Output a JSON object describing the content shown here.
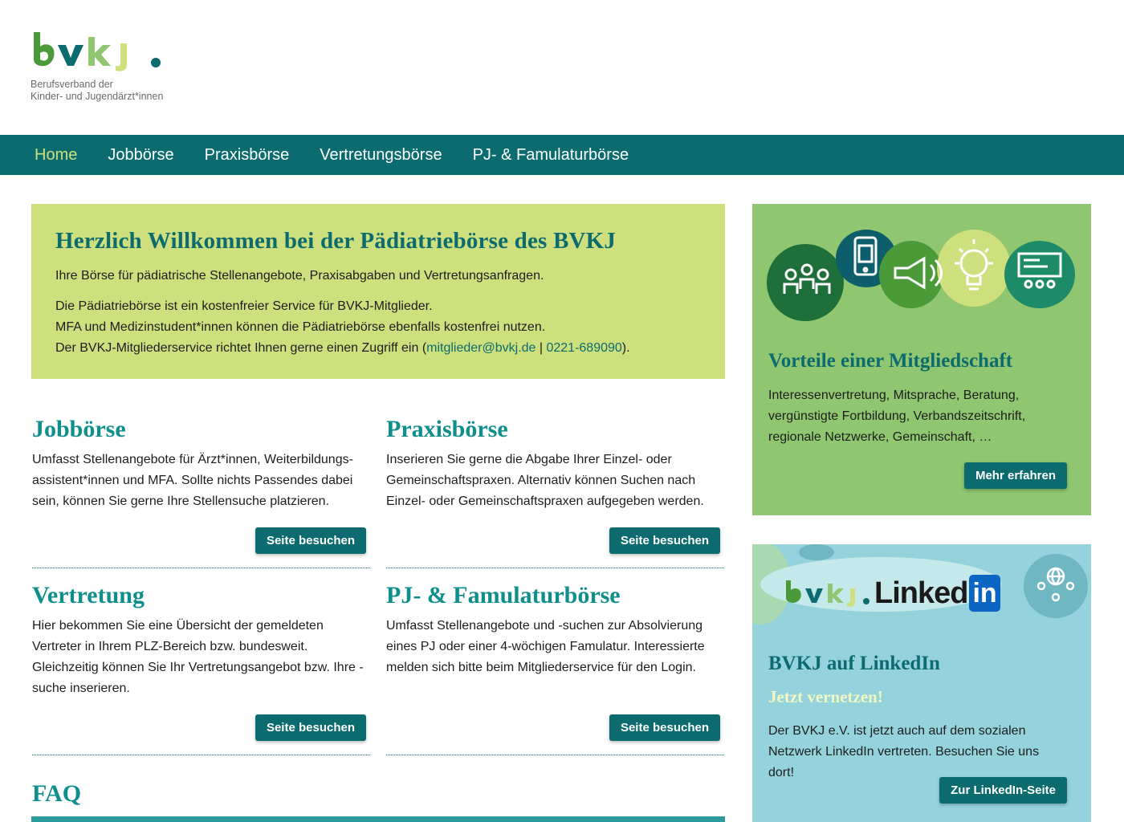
{
  "brand": {
    "logo_text": "bvkj.",
    "subtitle_line1": "Berufsverband der",
    "subtitle_line2": "Kinder- und Jugendärzt*innen"
  },
  "nav": {
    "items": [
      {
        "label": "Home",
        "active": true
      },
      {
        "label": "Jobbörse",
        "active": false
      },
      {
        "label": "Praxisbörse",
        "active": false
      },
      {
        "label": "Vertretungsbörse",
        "active": false
      },
      {
        "label": "PJ- & Famulaturbörse",
        "active": false
      }
    ]
  },
  "welcome": {
    "title": "Herzlich Willkommen bei der Pädiatriebörse des BVKJ",
    "intro": "Ihre Börse für pädiatrische Stellenangebote, Praxisabgaben und Vertretungsanfragen.",
    "line1": "Die Pädiatriebörse ist ein kostenfreier Service für BVKJ-Mitglieder.",
    "line2": "MFA und Medizinstudent*innen können die Pädiatriebörse ebenfalls kostenfrei nutzen.",
    "line3_pre": "Der BVKJ-Mitgliederservice richtet Ihnen gerne einen Zugriff ein (",
    "email": "mitglieder@bvkj.de",
    "sep": " | ",
    "phone": "0221-689090",
    "line3_post": ")."
  },
  "cards": [
    {
      "title": "Jobbörse",
      "text": "Umfasst Stellenangebote für Ärzt*innen, Weiterbildungs-assistent*innen und MFA. Sollte nichts Passendes dabei sein, können Sie gerne Ihre Stellensuche platzieren.",
      "button": "Seite besuchen"
    },
    {
      "title": "Praxisbörse",
      "text": "Inserieren Sie gerne die Abgabe Ihrer Einzel- oder Gemeinschaftspraxen. Alternativ können Suchen nach Einzel- oder Gemeinschaftspraxen aufgegeben werden.",
      "button": "Seite besuchen"
    },
    {
      "title": "Vertretung",
      "text": "Hier bekommen Sie eine Übersicht der gemeldeten Vertreter in Ihrem PLZ-Bereich bzw. bundesweit. Gleichzeitig können Sie Ihr Vertretungsangebot bzw. Ihre -suche inserieren.",
      "button": "Seite besuchen"
    },
    {
      "title": "PJ- & Famulaturbörse",
      "text": "Umfasst Stellenangebote und -suchen zur Absolvierung eines PJ oder einer 4-wöchigen Famulatur. Interessierte melden sich bitte beim Mitgliederservice für den Login.",
      "button": "Seite besuchen"
    }
  ],
  "faq": {
    "title": "FAQ"
  },
  "sidebar": {
    "membership": {
      "title": "Vorteile einer Mitgliedschaft",
      "text": "Interessenvertretung, Mitsprache, Beratung, vergünstigte Fortbildung, Verbandszeitschrift, regionale Netzwerke, Gemeinschaft, …",
      "button": "Mehr erfahren"
    },
    "linkedin": {
      "logo_bvkj": "bvkj",
      "logo_linked": "Linked",
      "logo_in": "in",
      "title": "BVKJ auf LinkedIn",
      "subtitle": "Jetzt vernetzen!",
      "text": "Der BVKJ e.V. ist jetzt auch auf dem sozialen Netzwerk LinkedIn vertreten. Besuchen Sie uns dort!",
      "button": "Zur LinkedIn-Seite"
    }
  },
  "colors": {
    "primary": "#0c6b6e",
    "accent_teal": "#0e8f8c",
    "lime": "#cde07d",
    "green": "#8fc66f",
    "light_blue": "#95d3dc"
  }
}
